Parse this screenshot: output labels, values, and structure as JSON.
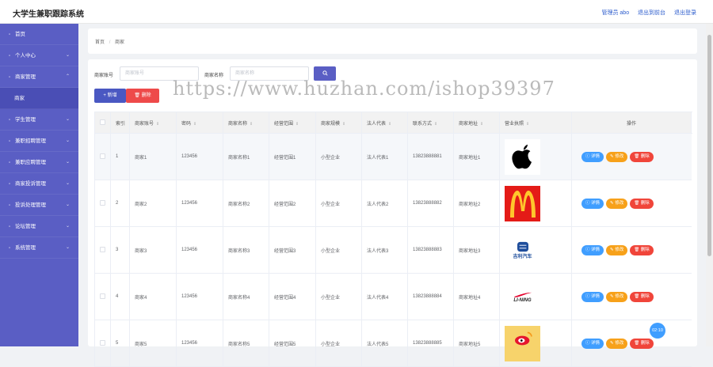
{
  "header": {
    "title": "大学生兼职跟踪系统",
    "user_label": "管理员 abo",
    "backend_label": "退出到前台",
    "logout_label": "退出登录"
  },
  "sidebar": {
    "items": [
      {
        "label": "首页",
        "icon": "home-icon",
        "chev": ""
      },
      {
        "label": "个人中心",
        "icon": "user-icon",
        "chev": "⌄"
      },
      {
        "label": "商家管理",
        "icon": "shop-icon",
        "chev": "⌃"
      },
      {
        "label": "商家",
        "icon": "",
        "chev": "",
        "sub": true
      },
      {
        "label": "学生管理",
        "icon": "student-icon",
        "chev": "⌄"
      },
      {
        "label": "兼职招聘管理",
        "icon": "job-icon",
        "chev": "⌄"
      },
      {
        "label": "兼职应聘管理",
        "icon": "apply-icon",
        "chev": "⌄"
      },
      {
        "label": "商家投诉管理",
        "icon": "complaint-icon",
        "chev": "⌄"
      },
      {
        "label": "投诉处理管理",
        "icon": "process-icon",
        "chev": "⌄"
      },
      {
        "label": "论坛管理",
        "icon": "forum-icon",
        "chev": "⌄"
      },
      {
        "label": "系统管理",
        "icon": "settings-icon",
        "chev": "⌄"
      }
    ]
  },
  "breadcrumb": {
    "home": "首页",
    "sep": "/",
    "current": "商家"
  },
  "search": {
    "account_label": "商家账号",
    "account_placeholder": "商家账号",
    "name_label": "商家名称",
    "name_placeholder": "商家名称",
    "search_icon": "search-icon"
  },
  "toolbar": {
    "add_label": "+ 新增",
    "delete_label": "删除"
  },
  "watermark": "https://www.huzhan.com/ishop39397",
  "table": {
    "headers": [
      "索引",
      "商家账号",
      "密码",
      "商家名称",
      "经营范围",
      "商家规模",
      "法人代表",
      "联系方式",
      "商家地址",
      "营业执照",
      "操作"
    ],
    "sort_glyph": "⇕",
    "actions": {
      "detail": "详情",
      "edit": "修改",
      "delete": "删除"
    },
    "rows": [
      {
        "index": "1",
        "account": "商家1",
        "password": "123456",
        "name": "商家名称1",
        "scope": "经营范围1",
        "scale": "小型企业",
        "legal": "法人代表1",
        "phone": "13823888881",
        "address": "商家地址1",
        "license": "apple"
      },
      {
        "index": "2",
        "account": "商家2",
        "password": "123456",
        "name": "商家名称2",
        "scope": "经营范围2",
        "scale": "小型企业",
        "legal": "法人代表2",
        "phone": "13823888882",
        "address": "商家地址2",
        "license": "mcdonalds"
      },
      {
        "index": "3",
        "account": "商家3",
        "password": "123456",
        "name": "商家名称3",
        "scope": "经营范围3",
        "scale": "小型企业",
        "legal": "法人代表3",
        "phone": "13823888883",
        "address": "商家地址3",
        "license": "geely",
        "logo_text": "吉利汽车"
      },
      {
        "index": "4",
        "account": "商家4",
        "password": "123456",
        "name": "商家名称4",
        "scope": "经营范围4",
        "scale": "小型企业",
        "legal": "法人代表4",
        "phone": "13823888884",
        "address": "商家地址4",
        "license": "lining",
        "logo_text": "LI-NING"
      },
      {
        "index": "5",
        "account": "商家5",
        "password": "123456",
        "name": "商家名称5",
        "scope": "经营范围5",
        "scale": "小型企业",
        "legal": "法人代表5",
        "phone": "13823888885",
        "address": "商家地址5",
        "license": "weibo"
      }
    ]
  },
  "clock_badge": "02:10"
}
